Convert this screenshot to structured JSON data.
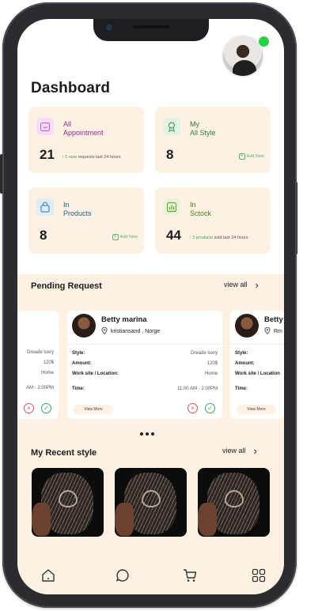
{
  "header": {
    "title": "Dashboard"
  },
  "stats": [
    {
      "label_line1": "All",
      "label_line2": "Appointment",
      "value": "21",
      "meta_highlight": "5 new",
      "meta_text": "requests last 24 hours",
      "action": "",
      "label_color": "#8a2d8f",
      "icon_color": "#c46bd0",
      "icon_bg": "#f6dff5",
      "icon": "calendar-icon"
    },
    {
      "label_line1": "My",
      "label_line2": "All Style",
      "value": "8",
      "meta_highlight": "",
      "meta_text": "",
      "action": "Add New",
      "label_color": "#2f7d3b",
      "icon_color": "#4f9b62",
      "icon_bg": "#e2f3e4",
      "icon": "award-icon"
    },
    {
      "label_line1": "In",
      "label_line2": "Products",
      "value": "8",
      "meta_highlight": "",
      "meta_text": "",
      "action": "Add New",
      "label_color": "#1e5f86",
      "icon_color": "#4b89b5",
      "icon_bg": "#e0ecf6",
      "icon": "bag-icon"
    },
    {
      "label_line1": "In",
      "label_line2": "Sctock",
      "value": "44",
      "meta_highlight": "3 products",
      "meta_text": "sold last 24 hours",
      "action": "",
      "label_color": "#4f7d1d",
      "icon_color": "#6da635",
      "icon_bg": "#e8f4dc",
      "icon": "chart-icon"
    }
  ],
  "pending": {
    "title": "Pending Request",
    "view_all": "view all",
    "cards": [
      {
        "name": "",
        "location": "",
        "style_value": "Dreade luxry",
        "amount_value": "120$",
        "work_value": "Home",
        "time_value": "AM - 2:00PM",
        "view_more": ""
      },
      {
        "name": "Betty marina",
        "location": "kristiansand , Norge",
        "style_label": "Style:",
        "style_value": "Dreade luxry",
        "amount_label": "Amount:",
        "amount_value": "120$",
        "work_label": "Work site / Location:",
        "work_value": "Home",
        "time_label": "Time:",
        "time_value": "11:00 AM - 2:00PM",
        "view_more": "View More"
      },
      {
        "name": "Betty",
        "location": "Rm",
        "style_label": "Style:",
        "amount_label": "Amount:",
        "work_label": "Work site / Location",
        "time_label": "Time:",
        "view_more": "View More"
      }
    ]
  },
  "recent": {
    "title": "My Recent style",
    "view_all": "view all"
  },
  "nav": [
    "home-icon",
    "chat-icon",
    "cart-icon",
    "apps-icon"
  ],
  "colors": {
    "accent_bg": "#fdf1e4",
    "online": "#2ecf47",
    "accept": "#3ca35a",
    "reject": "#d9534f"
  }
}
